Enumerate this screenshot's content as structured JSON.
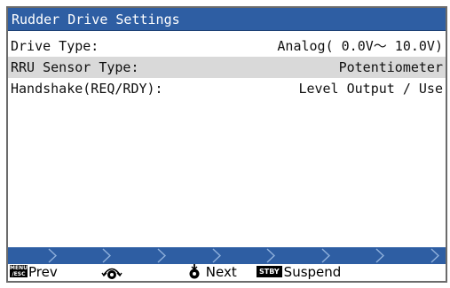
{
  "window": {
    "title": "Rudder Drive Settings"
  },
  "settings": [
    {
      "label": "Drive Type:",
      "value": "Analog(  0.0V〜 10.0V)"
    },
    {
      "label": "RRU Sensor Type:",
      "value": "Potentiometer"
    },
    {
      "label": "Handshake(REQ/RDY):",
      "value": "Level Output / Use"
    }
  ],
  "pager": {
    "total_steps": 8,
    "current_step": 8
  },
  "footer": {
    "menu_badge_top": "MENU",
    "menu_badge_bottom": "/ESC",
    "prev_label": "Prev",
    "next_label": "Next",
    "stby_badge": "STBY",
    "suspend_label": "Suspend",
    "knob_icon": "rotary-knob-icon",
    "push_icon": "knob-push-icon"
  },
  "colors": {
    "title_bar": "#2e5ea3",
    "selected_row": "#d9d9d9",
    "pager_chevrons": "#8fb0dc",
    "frame": "#6b6b6b"
  }
}
